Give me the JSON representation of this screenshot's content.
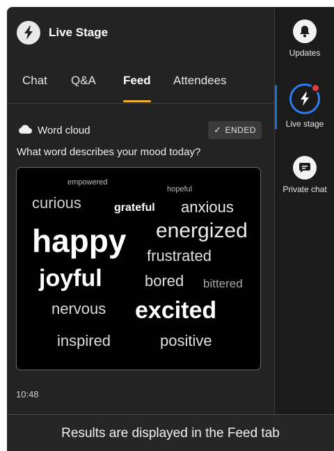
{
  "app": {
    "title": "Live Stage"
  },
  "tabs": [
    {
      "label": "Chat",
      "active": false
    },
    {
      "label": "Q&A",
      "active": false
    },
    {
      "label": "Feed",
      "active": true
    },
    {
      "label": "Attendees",
      "active": false
    }
  ],
  "feed": {
    "card_title": "Word cloud",
    "card_icon": "cloud-icon",
    "status_badge": "ENDED",
    "question": "What word describes your mood today?",
    "words": [
      {
        "text": "empowered",
        "weight": 1
      },
      {
        "text": "hopeful",
        "weight": 1
      },
      {
        "text": "curious",
        "weight": 3
      },
      {
        "text": "grateful",
        "weight": 3
      },
      {
        "text": "anxious",
        "weight": 4
      },
      {
        "text": "happy",
        "weight": 9
      },
      {
        "text": "energized",
        "weight": 6
      },
      {
        "text": "frustrated",
        "weight": 4
      },
      {
        "text": "joyful",
        "weight": 7
      },
      {
        "text": "bored",
        "weight": 4
      },
      {
        "text": "bittered",
        "weight": 3
      },
      {
        "text": "nervous",
        "weight": 4
      },
      {
        "text": "excited",
        "weight": 7
      },
      {
        "text": "inspired",
        "weight": 4
      },
      {
        "text": "positive",
        "weight": 4
      }
    ],
    "timestamp": "10:48"
  },
  "rail": {
    "items": [
      {
        "label": "Updates",
        "icon": "bell-icon",
        "active": false
      },
      {
        "label": "Live stage",
        "icon": "lightning-icon",
        "active": true,
        "has_notification": true
      },
      {
        "label": "Private chat",
        "icon": "chat-bubble-icon",
        "active": false
      }
    ]
  },
  "caption": "Results are displayed in the Feed tab",
  "colors": {
    "background": "#232323",
    "rail_background": "#1b1b1b",
    "tab_indicator": "#f2b233",
    "active_ring": "#2f7cf0",
    "notification": "#e23b3b",
    "cloud_background": "#000000"
  }
}
